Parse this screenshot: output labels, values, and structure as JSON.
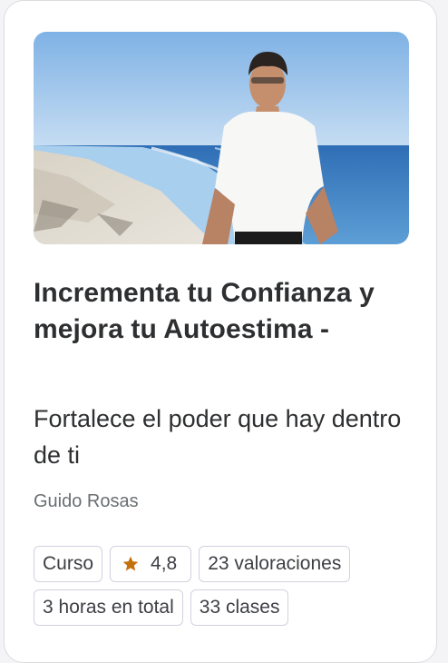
{
  "course": {
    "title": "Incrementa tu Confianza y mejora tu Autoestima -",
    "subtitle": "Fortalece el poder que hay dentro de ti",
    "instructor": "Guido Rosas",
    "thumbnail_alt": "Instructor en la playa con camiseta blanca"
  },
  "badges": {
    "type": "Curso",
    "rating": "4,8",
    "reviews": "23 valoraciones",
    "duration": "3 horas en total",
    "lessons": "33 clases"
  },
  "icons": {
    "rating": "star-icon"
  },
  "colors": {
    "star": "#c4710d",
    "text_primary": "#2d2f31",
    "text_secondary": "#6a6f73",
    "badge_border": "#d1d2e0"
  }
}
